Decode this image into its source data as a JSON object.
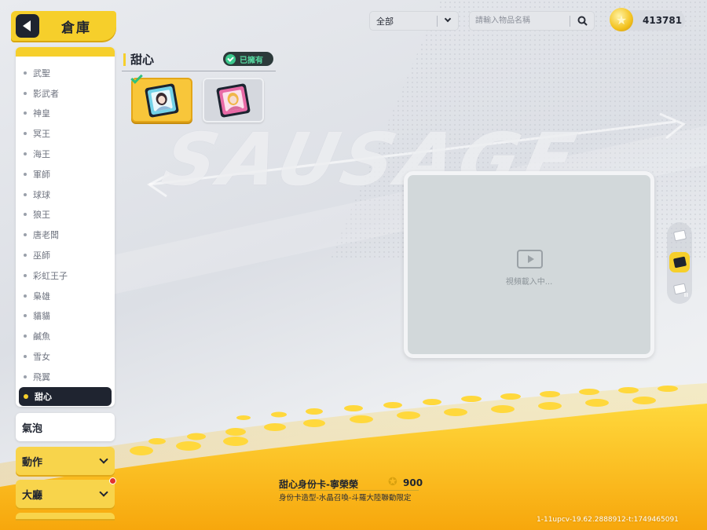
{
  "header": {
    "title": "倉庫"
  },
  "sidebar": {
    "items": [
      {
        "label": "武聖"
      },
      {
        "label": "影武者"
      },
      {
        "label": "神皇"
      },
      {
        "label": "冥王"
      },
      {
        "label": "海王"
      },
      {
        "label": "軍師"
      },
      {
        "label": "球球"
      },
      {
        "label": "狼王"
      },
      {
        "label": "唐老闆"
      },
      {
        "label": "巫師"
      },
      {
        "label": "彩虹王子"
      },
      {
        "label": "梟雄"
      },
      {
        "label": "貓貓"
      },
      {
        "label": "鹹魚"
      },
      {
        "label": "雪女"
      },
      {
        "label": "飛翼"
      },
      {
        "label": "甜心",
        "active": true
      }
    ]
  },
  "categories": {
    "bubble": "氣泡",
    "action": "動作",
    "lobby": "大廳"
  },
  "filter": {
    "selected": "全部"
  },
  "search": {
    "placeholder": "請輸入物品名稱"
  },
  "currency": {
    "amount": "413781",
    "icon": "star-coin-icon",
    "color": "#f3c21e"
  },
  "section": {
    "title": "甜心",
    "owned_label": "已擁有"
  },
  "items": [
    {
      "name": "item-card-1",
      "selected": true,
      "owned": true
    },
    {
      "name": "item-card-2",
      "selected": false,
      "owned": false
    }
  ],
  "video": {
    "loading_text": "視頻載入中..."
  },
  "detail": {
    "name": "甜心身份卡-寧榮榮",
    "price": "900",
    "description": "身份卡造型-水晶召喚-斗羅大陸聯動限定"
  },
  "side_tabs": [
    {
      "id": "I",
      "active": true
    },
    {
      "id": "II",
      "active": false
    }
  ],
  "version": "1-11upcv-19.62.2888912-t:1749465091",
  "colors": {
    "accent": "#f6cf2b",
    "dark": "#1f2430",
    "owned_green": "#3bc98d"
  }
}
